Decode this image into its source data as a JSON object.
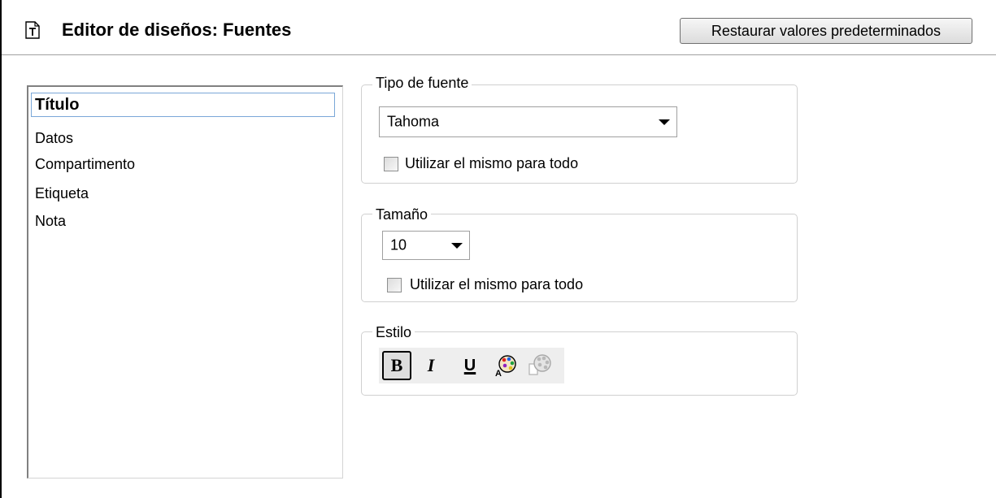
{
  "header": {
    "title": "Editor de diseños: Fuentes",
    "restore_button": "Restaurar valores predeterminados"
  },
  "element_list": {
    "selected": "Título",
    "items": [
      "Título",
      "Datos",
      "Compartimento",
      "Etiqueta",
      "Nota"
    ]
  },
  "font_type": {
    "group_label": "Tipo de fuente",
    "selected": "Tahoma",
    "same_for_all_label": "Utilizar el mismo para todo",
    "same_for_all_checked": false
  },
  "font_size": {
    "group_label": "Tamaño",
    "selected": "10",
    "same_for_all_label": "Utilizar el mismo para todo",
    "same_for_all_checked": false
  },
  "style": {
    "group_label": "Estilo",
    "bold_label": "B",
    "italic_label": "I",
    "underline_label": "U",
    "bold_active": true,
    "text_color_icon": "palette-icon",
    "background_color_icon": "palette-disabled-icon"
  },
  "colors": {
    "selection_border": "#7aa7d8",
    "group_border": "#d0d0d0",
    "button_gradient_top": "#f6f6f6",
    "button_gradient_bottom": "#dcdcdc"
  }
}
